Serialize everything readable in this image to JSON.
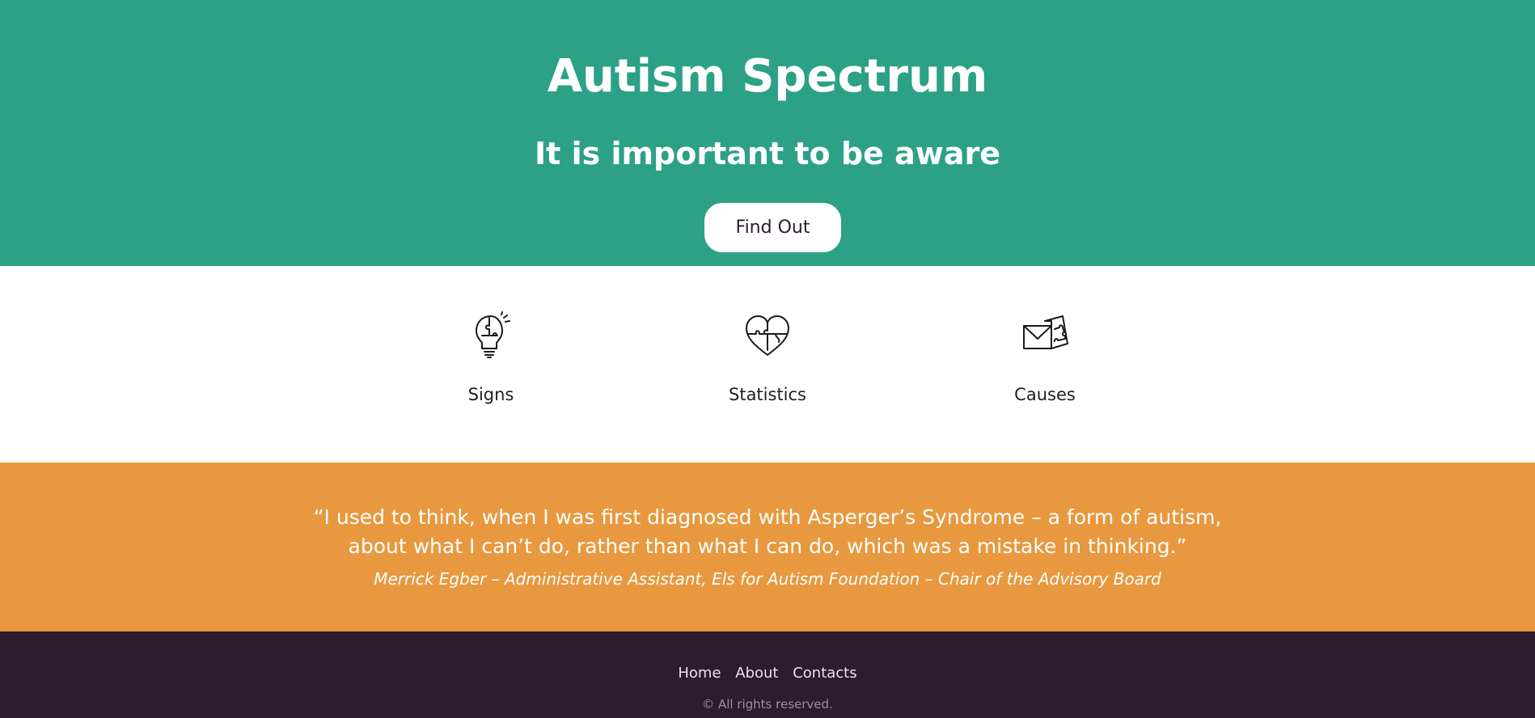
{
  "hero": {
    "title": "Autism Spectrum",
    "subtitle": "It is important to be aware",
    "button_label": "Find Out"
  },
  "features": [
    {
      "label": "Signs",
      "icon": "lightbulb-puzzle-icon"
    },
    {
      "label": "Statistics",
      "icon": "heart-puzzle-icon"
    },
    {
      "label": "Causes",
      "icon": "envelope-puzzle-icon"
    }
  ],
  "quote": {
    "text": "“I used to think, when I was first diagnosed with Asperger’s Syndrome – a form of autism, about what I can’t do, rather than what I can do, which was a mistake in thinking.”",
    "author": "Merrick Egber – Administrative Assistant, Els for Autism Foundation – Chair of the Advisory Board"
  },
  "footer": {
    "nav": [
      "Home",
      "About",
      "Contacts"
    ],
    "copyright": "© All rights reserved."
  },
  "colors": {
    "hero_bg": "#2ca186",
    "quote_bg": "#e8983f",
    "footer_bg": "#2d1b2e",
    "text_dark": "#2b1b2e"
  }
}
